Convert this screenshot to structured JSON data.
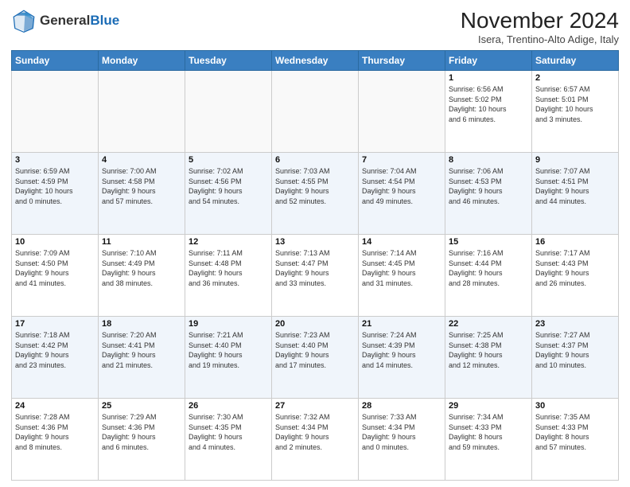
{
  "header": {
    "logo_general": "General",
    "logo_blue": "Blue",
    "month_title": "November 2024",
    "subtitle": "Isera, Trentino-Alto Adige, Italy"
  },
  "days_of_week": [
    "Sunday",
    "Monday",
    "Tuesday",
    "Wednesday",
    "Thursday",
    "Friday",
    "Saturday"
  ],
  "weeks": [
    [
      {
        "day": "",
        "info": ""
      },
      {
        "day": "",
        "info": ""
      },
      {
        "day": "",
        "info": ""
      },
      {
        "day": "",
        "info": ""
      },
      {
        "day": "",
        "info": ""
      },
      {
        "day": "1",
        "info": "Sunrise: 6:56 AM\nSunset: 5:02 PM\nDaylight: 10 hours\nand 6 minutes."
      },
      {
        "day": "2",
        "info": "Sunrise: 6:57 AM\nSunset: 5:01 PM\nDaylight: 10 hours\nand 3 minutes."
      }
    ],
    [
      {
        "day": "3",
        "info": "Sunrise: 6:59 AM\nSunset: 4:59 PM\nDaylight: 10 hours\nand 0 minutes."
      },
      {
        "day": "4",
        "info": "Sunrise: 7:00 AM\nSunset: 4:58 PM\nDaylight: 9 hours\nand 57 minutes."
      },
      {
        "day": "5",
        "info": "Sunrise: 7:02 AM\nSunset: 4:56 PM\nDaylight: 9 hours\nand 54 minutes."
      },
      {
        "day": "6",
        "info": "Sunrise: 7:03 AM\nSunset: 4:55 PM\nDaylight: 9 hours\nand 52 minutes."
      },
      {
        "day": "7",
        "info": "Sunrise: 7:04 AM\nSunset: 4:54 PM\nDaylight: 9 hours\nand 49 minutes."
      },
      {
        "day": "8",
        "info": "Sunrise: 7:06 AM\nSunset: 4:53 PM\nDaylight: 9 hours\nand 46 minutes."
      },
      {
        "day": "9",
        "info": "Sunrise: 7:07 AM\nSunset: 4:51 PM\nDaylight: 9 hours\nand 44 minutes."
      }
    ],
    [
      {
        "day": "10",
        "info": "Sunrise: 7:09 AM\nSunset: 4:50 PM\nDaylight: 9 hours\nand 41 minutes."
      },
      {
        "day": "11",
        "info": "Sunrise: 7:10 AM\nSunset: 4:49 PM\nDaylight: 9 hours\nand 38 minutes."
      },
      {
        "day": "12",
        "info": "Sunrise: 7:11 AM\nSunset: 4:48 PM\nDaylight: 9 hours\nand 36 minutes."
      },
      {
        "day": "13",
        "info": "Sunrise: 7:13 AM\nSunset: 4:47 PM\nDaylight: 9 hours\nand 33 minutes."
      },
      {
        "day": "14",
        "info": "Sunrise: 7:14 AM\nSunset: 4:45 PM\nDaylight: 9 hours\nand 31 minutes."
      },
      {
        "day": "15",
        "info": "Sunrise: 7:16 AM\nSunset: 4:44 PM\nDaylight: 9 hours\nand 28 minutes."
      },
      {
        "day": "16",
        "info": "Sunrise: 7:17 AM\nSunset: 4:43 PM\nDaylight: 9 hours\nand 26 minutes."
      }
    ],
    [
      {
        "day": "17",
        "info": "Sunrise: 7:18 AM\nSunset: 4:42 PM\nDaylight: 9 hours\nand 23 minutes."
      },
      {
        "day": "18",
        "info": "Sunrise: 7:20 AM\nSunset: 4:41 PM\nDaylight: 9 hours\nand 21 minutes."
      },
      {
        "day": "19",
        "info": "Sunrise: 7:21 AM\nSunset: 4:40 PM\nDaylight: 9 hours\nand 19 minutes."
      },
      {
        "day": "20",
        "info": "Sunrise: 7:23 AM\nSunset: 4:40 PM\nDaylight: 9 hours\nand 17 minutes."
      },
      {
        "day": "21",
        "info": "Sunrise: 7:24 AM\nSunset: 4:39 PM\nDaylight: 9 hours\nand 14 minutes."
      },
      {
        "day": "22",
        "info": "Sunrise: 7:25 AM\nSunset: 4:38 PM\nDaylight: 9 hours\nand 12 minutes."
      },
      {
        "day": "23",
        "info": "Sunrise: 7:27 AM\nSunset: 4:37 PM\nDaylight: 9 hours\nand 10 minutes."
      }
    ],
    [
      {
        "day": "24",
        "info": "Sunrise: 7:28 AM\nSunset: 4:36 PM\nDaylight: 9 hours\nand 8 minutes."
      },
      {
        "day": "25",
        "info": "Sunrise: 7:29 AM\nSunset: 4:36 PM\nDaylight: 9 hours\nand 6 minutes."
      },
      {
        "day": "26",
        "info": "Sunrise: 7:30 AM\nSunset: 4:35 PM\nDaylight: 9 hours\nand 4 minutes."
      },
      {
        "day": "27",
        "info": "Sunrise: 7:32 AM\nSunset: 4:34 PM\nDaylight: 9 hours\nand 2 minutes."
      },
      {
        "day": "28",
        "info": "Sunrise: 7:33 AM\nSunset: 4:34 PM\nDaylight: 9 hours\nand 0 minutes."
      },
      {
        "day": "29",
        "info": "Sunrise: 7:34 AM\nSunset: 4:33 PM\nDaylight: 8 hours\nand 59 minutes."
      },
      {
        "day": "30",
        "info": "Sunrise: 7:35 AM\nSunset: 4:33 PM\nDaylight: 8 hours\nand 57 minutes."
      }
    ]
  ]
}
